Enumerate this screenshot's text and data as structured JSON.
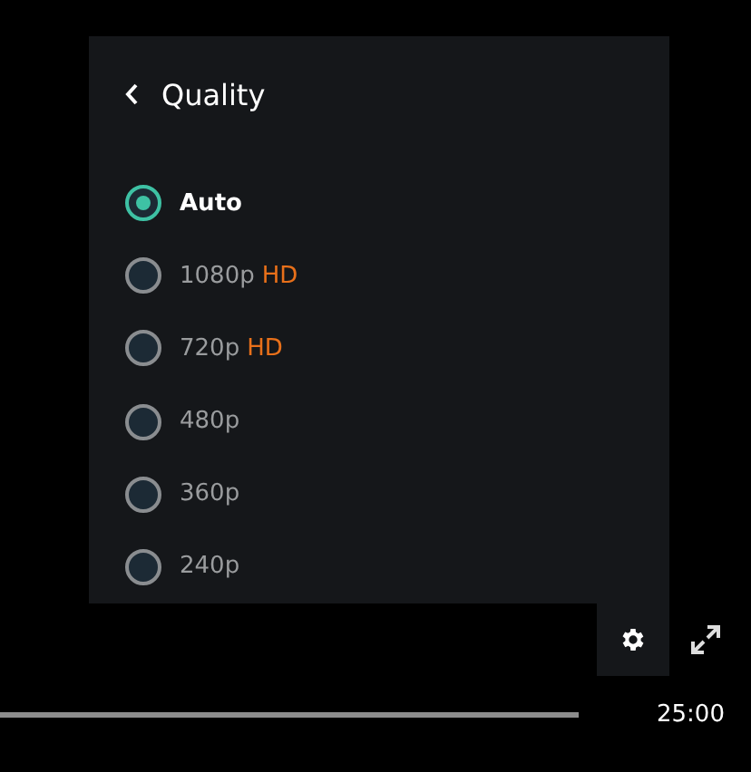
{
  "menu": {
    "title": "Quality",
    "options": [
      {
        "label": "Auto",
        "selected": true
      },
      {
        "label": "1080p",
        "badge": "HD",
        "selected": false
      },
      {
        "label": "720p",
        "badge": "HD",
        "selected": false
      },
      {
        "label": "480p",
        "selected": false
      },
      {
        "label": "360p",
        "selected": false
      },
      {
        "label": "240p",
        "selected": false
      }
    ]
  },
  "controls": {
    "settings_open": true
  },
  "time": "25:00"
}
